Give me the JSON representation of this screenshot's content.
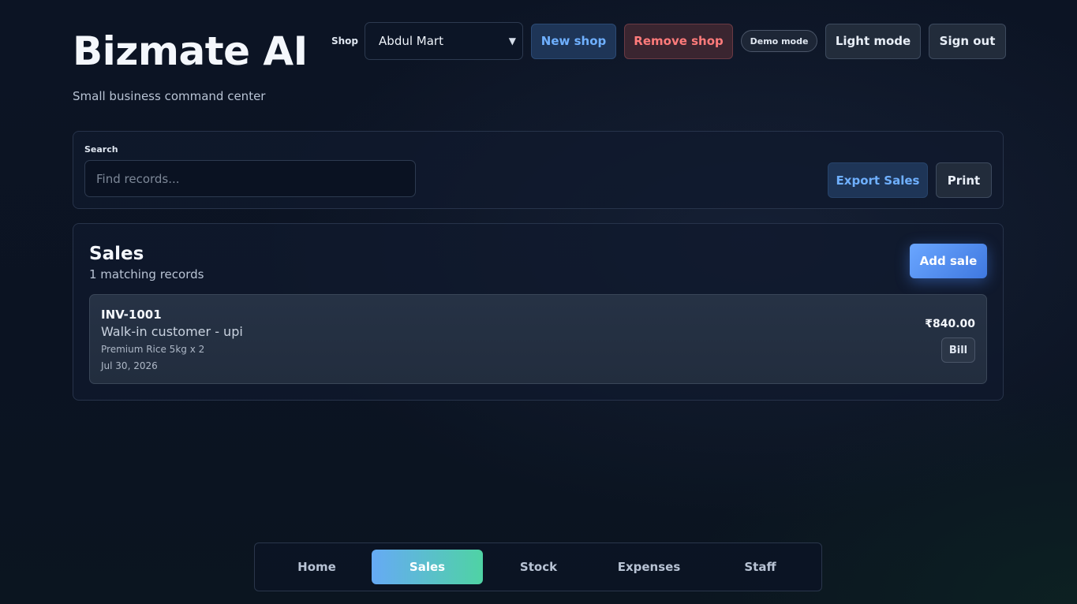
{
  "brand": {
    "title": "Bizmate AI",
    "subtitle": "Small business command center"
  },
  "header": {
    "shop_label": "Shop",
    "shop_selected": "Abdul Mart",
    "new_shop": "New shop",
    "remove_shop": "Remove shop",
    "demo_mode": "Demo mode",
    "light_mode": "Light mode",
    "sign_out": "Sign out"
  },
  "search": {
    "label": "Search",
    "placeholder": "Find records...",
    "value": "",
    "export_label": "Export Sales",
    "print_label": "Print"
  },
  "sales": {
    "title": "Sales",
    "count_text": "1 matching records",
    "add_label": "Add sale",
    "records": [
      {
        "id": "INV-1001",
        "customer": "Walk-in customer - upi",
        "items": "Premium Rice 5kg x 2",
        "date": "Jul 30, 2026",
        "amount": "₹840.00",
        "bill_label": "Bill"
      }
    ]
  },
  "nav": {
    "active": "Sales",
    "items": [
      {
        "label": "Home"
      },
      {
        "label": "Sales"
      },
      {
        "label": "Stock"
      },
      {
        "label": "Expenses"
      },
      {
        "label": "Staff"
      }
    ]
  },
  "colors": {
    "accent_blue": "#6fb0ff",
    "danger": "#ff7b7b",
    "nav_gradient_start": "#66aaf5",
    "nav_gradient_end": "#4fd3a4",
    "background": "#0b1322"
  }
}
